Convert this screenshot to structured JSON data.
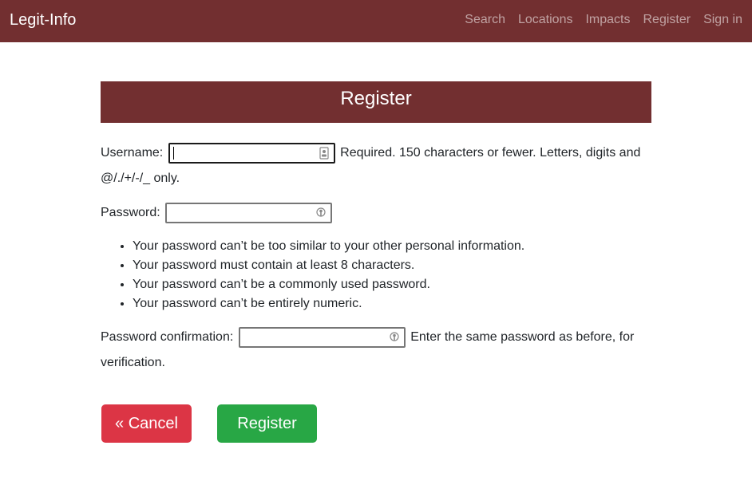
{
  "nav": {
    "brand": "Legit-Info",
    "links": [
      "Search",
      "Locations",
      "Impacts",
      "Register",
      "Sign in"
    ]
  },
  "card": {
    "title": "Register"
  },
  "form": {
    "username_label": "Username:",
    "username_value": "",
    "username_help": "Required. 150 characters or fewer. Letters, digits and @/./+/-/_ only.",
    "password_label": "Password:",
    "password_value": "",
    "password_rules": [
      "Your password can’t be too similar to your other personal information.",
      "Your password must contain at least 8 characters.",
      "Your password can’t be a commonly used password.",
      "Your password can’t be entirely numeric."
    ],
    "confirm_label": "Password confirmation:",
    "confirm_value": "",
    "confirm_help": "Enter the same password as before, for verification."
  },
  "buttons": {
    "cancel": "« Cancel",
    "register": "Register »"
  },
  "colors": {
    "brand": "#722f30",
    "cancel": "#dc3545",
    "register": "#28a745"
  }
}
